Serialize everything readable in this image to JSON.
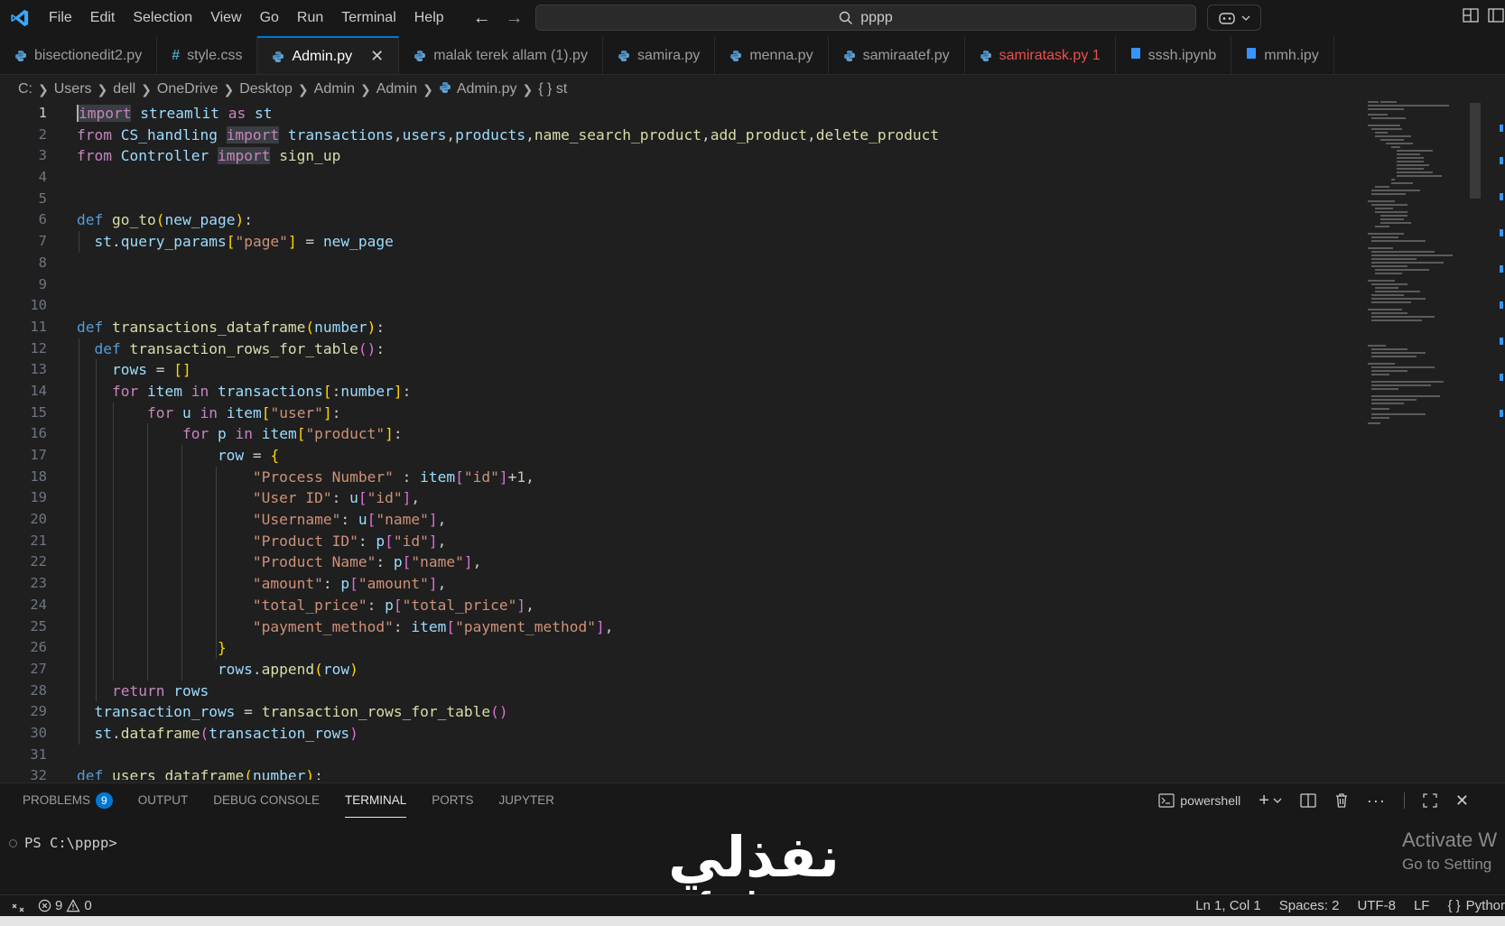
{
  "titlebar": {
    "menu": [
      "File",
      "Edit",
      "Selection",
      "View",
      "Go",
      "Run",
      "Terminal",
      "Help"
    ],
    "search_text": "pppp",
    "colors": {
      "accent": "#0078d4",
      "logo": "#3ea6f5"
    }
  },
  "tabs": [
    {
      "label": "bisectionedit2.py",
      "icon": "python-icon"
    },
    {
      "label": "style.css",
      "icon": "hash-icon"
    },
    {
      "label": "Admin.py",
      "icon": "python-icon",
      "active": true
    },
    {
      "label": "malak terek allam (1).py",
      "icon": "python-icon"
    },
    {
      "label": "samira.py",
      "icon": "python-icon"
    },
    {
      "label": "menna.py",
      "icon": "python-icon"
    },
    {
      "label": "samiraatef.py",
      "icon": "python-icon"
    },
    {
      "label": "samiratask.py 1",
      "icon": "python-icon",
      "error": true
    },
    {
      "label": "sssh.ipynb",
      "icon": "notebook-icon"
    },
    {
      "label": "mmh.ipy",
      "icon": "notebook-icon"
    }
  ],
  "breadcrumb": [
    "C:",
    "Users",
    "dell",
    "OneDrive",
    "Desktop",
    "Admin",
    "Admin",
    "Admin.py",
    "{ } st"
  ],
  "editor": {
    "current_line": 1,
    "line_numbers": [
      "1",
      "2",
      "3",
      "4",
      "5",
      "6",
      "7",
      "8",
      "9",
      "10",
      "11",
      "12",
      "13",
      "14",
      "15",
      "16",
      "17",
      "18",
      "19",
      "20",
      "21",
      "22",
      "23",
      "24",
      "25",
      "26",
      "27",
      "28",
      "29",
      "30",
      "31",
      "32"
    ]
  },
  "panel": {
    "tabs": [
      "PROBLEMS",
      "OUTPUT",
      "DEBUG CONSOLE",
      "TERMINAL",
      "PORTS",
      "JUPYTER"
    ],
    "problems_count": "9",
    "active_tab": "TERMINAL",
    "shell": "powershell",
    "prompt": "PS C:\\pppp>",
    "activate_title": "Activate W",
    "activate_sub": "Go to Setting"
  },
  "watermark": {
    "arabic": "نفذلي",
    "latin": "nafezlu.com"
  },
  "statusbar": {
    "errors": "9",
    "warnings": "0",
    "position": "Ln 1, Col 1",
    "spaces": "Spaces: 2",
    "encoding": "UTF-8",
    "eol": "LF",
    "language": "Pythor"
  }
}
